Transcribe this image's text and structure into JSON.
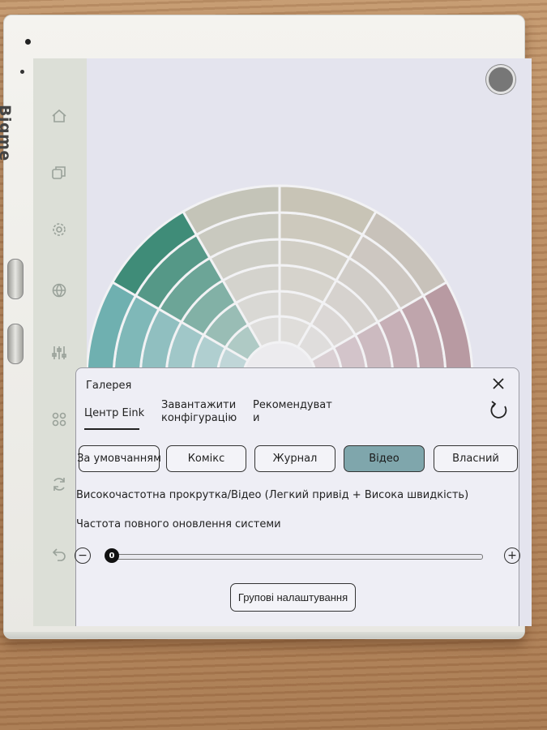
{
  "device": {
    "brand": "Bigme"
  },
  "rail": {
    "icons": [
      "home-icon",
      "layers-icon",
      "gear-icon",
      "globe-icon",
      "sliders-icon",
      "apps-icon",
      "sync-icon",
      "back-icon"
    ]
  },
  "panel": {
    "title": "Галерея",
    "tabs": [
      {
        "label": "Центр Eink",
        "active": true
      },
      {
        "label": "Завантажити\nконфігурацію",
        "active": false
      },
      {
        "label": "Рекомендуват\nи",
        "active": false
      }
    ],
    "modes": [
      {
        "label": "За умовчанням",
        "active": false
      },
      {
        "label": "Комікс",
        "active": false
      },
      {
        "label": "Журнал",
        "active": false
      },
      {
        "label": "Відео",
        "active": true
      },
      {
        "label": "Власний",
        "active": false
      }
    ],
    "mode_description": "Високочастотна прокрутка/Відео (Легкий привід + Висока швидкість)",
    "refresh_label": "Частота повного оновлення системи",
    "slider": {
      "value": "0",
      "minus": "−",
      "plus": "+"
    },
    "group_settings_label": "Групові налаштування"
  },
  "colors": {
    "active_mode": "#7fa6ac",
    "wheel_green": "#3f8c78",
    "wheel_teal": "#6fb0b0",
    "wheel_maroon": "#8c4a60"
  }
}
